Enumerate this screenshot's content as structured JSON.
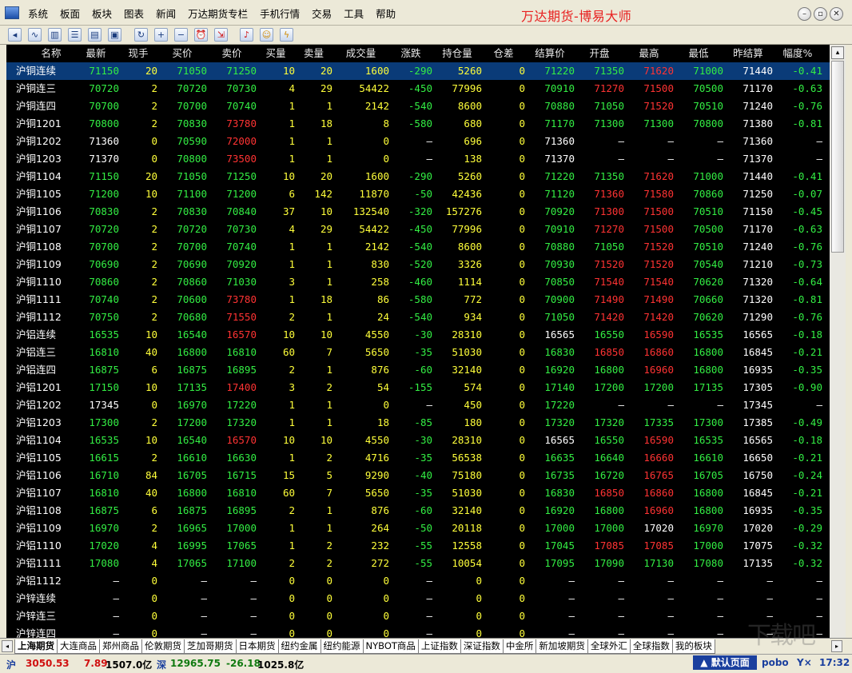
{
  "menu": {
    "items": [
      "系统",
      "板面",
      "板块",
      "图表",
      "新闻",
      "万达期货专栏",
      "手机行情",
      "交易",
      "工具",
      "帮助"
    ],
    "brand": "万达期货-博易大师"
  },
  "window_buttons": [
    "minimize",
    "restore",
    "close"
  ],
  "toolbar": {
    "icons": [
      "back-icon",
      "line-chart-icon",
      "candlestick-icon",
      "quote-list-icon",
      "news-icon",
      "f10-icon",
      "refresh-icon",
      "zoom-in-icon",
      "zoom-out-icon",
      "alarm-clock-icon",
      "export-icon",
      "bell-icon",
      "users-icon",
      "lightning-icon"
    ]
  },
  "columns": [
    "名称",
    "最新",
    "现手",
    "买价",
    "卖价",
    "买量",
    "卖量",
    "成交量",
    "涨跌",
    "持仓量",
    "仓差",
    "结算价",
    "开盘",
    "最高",
    "最低",
    "昨结算",
    "幅度%"
  ],
  "rows": [
    [
      "沪铜连续",
      "71150",
      "20",
      "71050",
      "71250",
      "10",
      "20",
      "1600",
      "-290",
      "5260",
      "0",
      "71220",
      "71350",
      "71620",
      "71000",
      "71440",
      "-0.41"
    ],
    [
      "沪铜连三",
      "70720",
      "2",
      "70720",
      "70730",
      "4",
      "29",
      "54422",
      "-450",
      "77996",
      "0",
      "70910",
      "71270",
      "71500",
      "70500",
      "71170",
      "-0.63"
    ],
    [
      "沪铜连四",
      "70700",
      "2",
      "70700",
      "70740",
      "1",
      "1",
      "2142",
      "-540",
      "8600",
      "0",
      "70880",
      "71050",
      "71520",
      "70510",
      "71240",
      "-0.76"
    ],
    [
      "沪铜1201",
      "70800",
      "2",
      "70830",
      "73780",
      "1",
      "18",
      "8",
      "-580",
      "680",
      "0",
      "71170",
      "71300",
      "71300",
      "70800",
      "71380",
      "-0.81"
    ],
    [
      "沪铜1202",
      "71360",
      "0",
      "70590",
      "72000",
      "1",
      "1",
      "0",
      "—",
      "696",
      "0",
      "71360",
      "—",
      "—",
      "—",
      "71360",
      "—"
    ],
    [
      "沪铜1203",
      "71370",
      "0",
      "70800",
      "73500",
      "1",
      "1",
      "0",
      "—",
      "138",
      "0",
      "71370",
      "—",
      "—",
      "—",
      "71370",
      "—"
    ],
    [
      "沪铜1104",
      "71150",
      "20",
      "71050",
      "71250",
      "10",
      "20",
      "1600",
      "-290",
      "5260",
      "0",
      "71220",
      "71350",
      "71620",
      "71000",
      "71440",
      "-0.41"
    ],
    [
      "沪铜1105",
      "71200",
      "10",
      "71100",
      "71200",
      "6",
      "142",
      "11870",
      "-50",
      "42436",
      "0",
      "71120",
      "71360",
      "71580",
      "70860",
      "71250",
      "-0.07"
    ],
    [
      "沪铜1106",
      "70830",
      "2",
      "70830",
      "70840",
      "37",
      "10",
      "132540",
      "-320",
      "157276",
      "0",
      "70920",
      "71300",
      "71500",
      "70510",
      "71150",
      "-0.45"
    ],
    [
      "沪铜1107",
      "70720",
      "2",
      "70720",
      "70730",
      "4",
      "29",
      "54422",
      "-450",
      "77996",
      "0",
      "70910",
      "71270",
      "71500",
      "70500",
      "71170",
      "-0.63"
    ],
    [
      "沪铜1108",
      "70700",
      "2",
      "70700",
      "70740",
      "1",
      "1",
      "2142",
      "-540",
      "8600",
      "0",
      "70880",
      "71050",
      "71520",
      "70510",
      "71240",
      "-0.76"
    ],
    [
      "沪铜1109",
      "70690",
      "2",
      "70690",
      "70920",
      "1",
      "1",
      "830",
      "-520",
      "3326",
      "0",
      "70930",
      "71520",
      "71520",
      "70540",
      "71210",
      "-0.73"
    ],
    [
      "沪铜1110",
      "70860",
      "2",
      "70860",
      "71030",
      "3",
      "1",
      "258",
      "-460",
      "1114",
      "0",
      "70850",
      "71540",
      "71540",
      "70620",
      "71320",
      "-0.64"
    ],
    [
      "沪铜1111",
      "70740",
      "2",
      "70600",
      "73780",
      "1",
      "18",
      "86",
      "-580",
      "772",
      "0",
      "70900",
      "71490",
      "71490",
      "70660",
      "71320",
      "-0.81"
    ],
    [
      "沪铜1112",
      "70750",
      "2",
      "70680",
      "71550",
      "2",
      "1",
      "24",
      "-540",
      "934",
      "0",
      "71050",
      "71420",
      "71420",
      "70620",
      "71290",
      "-0.76"
    ],
    [
      "沪铝连续",
      "16535",
      "10",
      "16540",
      "16570",
      "10",
      "10",
      "4550",
      "-30",
      "28310",
      "0",
      "16565",
      "16550",
      "16590",
      "16535",
      "16565",
      "-0.18"
    ],
    [
      "沪铝连三",
      "16810",
      "40",
      "16800",
      "16810",
      "60",
      "7",
      "5650",
      "-35",
      "51030",
      "0",
      "16830",
      "16850",
      "16860",
      "16800",
      "16845",
      "-0.21"
    ],
    [
      "沪铝连四",
      "16875",
      "6",
      "16875",
      "16895",
      "2",
      "1",
      "876",
      "-60",
      "32140",
      "0",
      "16920",
      "16800",
      "16960",
      "16800",
      "16935",
      "-0.35"
    ],
    [
      "沪铝1201",
      "17150",
      "10",
      "17135",
      "17400",
      "3",
      "2",
      "54",
      "-155",
      "574",
      "0",
      "17140",
      "17200",
      "17200",
      "17135",
      "17305",
      "-0.90"
    ],
    [
      "沪铝1202",
      "17345",
      "0",
      "16970",
      "17220",
      "1",
      "1",
      "0",
      "—",
      "450",
      "0",
      "17220",
      "—",
      "—",
      "—",
      "17345",
      "—"
    ],
    [
      "沪铝1203",
      "17300",
      "2",
      "17200",
      "17320",
      "1",
      "1",
      "18",
      "-85",
      "180",
      "0",
      "17320",
      "17320",
      "17335",
      "17300",
      "17385",
      "-0.49"
    ],
    [
      "沪铝1104",
      "16535",
      "10",
      "16540",
      "16570",
      "10",
      "10",
      "4550",
      "-30",
      "28310",
      "0",
      "16565",
      "16550",
      "16590",
      "16535",
      "16565",
      "-0.18"
    ],
    [
      "沪铝1105",
      "16615",
      "2",
      "16610",
      "16630",
      "1",
      "2",
      "4716",
      "-35",
      "56538",
      "0",
      "16635",
      "16640",
      "16660",
      "16610",
      "16650",
      "-0.21"
    ],
    [
      "沪铝1106",
      "16710",
      "84",
      "16705",
      "16715",
      "15",
      "5",
      "9290",
      "-40",
      "75180",
      "0",
      "16735",
      "16720",
      "16765",
      "16705",
      "16750",
      "-0.24"
    ],
    [
      "沪铝1107",
      "16810",
      "40",
      "16800",
      "16810",
      "60",
      "7",
      "5650",
      "-35",
      "51030",
      "0",
      "16830",
      "16850",
      "16860",
      "16800",
      "16845",
      "-0.21"
    ],
    [
      "沪铝1108",
      "16875",
      "6",
      "16875",
      "16895",
      "2",
      "1",
      "876",
      "-60",
      "32140",
      "0",
      "16920",
      "16800",
      "16960",
      "16800",
      "16935",
      "-0.35"
    ],
    [
      "沪铝1109",
      "16970",
      "2",
      "16965",
      "17000",
      "1",
      "1",
      "264",
      "-50",
      "20118",
      "0",
      "17000",
      "17000",
      "17020",
      "16970",
      "17020",
      "-0.29"
    ],
    [
      "沪铝1110",
      "17020",
      "4",
      "16995",
      "17065",
      "1",
      "2",
      "232",
      "-55",
      "12558",
      "0",
      "17045",
      "17085",
      "17085",
      "17000",
      "17075",
      "-0.32"
    ],
    [
      "沪铝1111",
      "17080",
      "4",
      "17065",
      "17100",
      "2",
      "2",
      "272",
      "-55",
      "10054",
      "0",
      "17095",
      "17090",
      "17130",
      "17080",
      "17135",
      "-0.32"
    ],
    [
      "沪铝1112",
      "—",
      "0",
      "—",
      "—",
      "0",
      "0",
      "0",
      "—",
      "0",
      "0",
      "—",
      "—",
      "—",
      "—",
      "—",
      "—"
    ],
    [
      "沪锌连续",
      "—",
      "0",
      "—",
      "—",
      "0",
      "0",
      "0",
      "—",
      "0",
      "0",
      "—",
      "—",
      "—",
      "—",
      "—",
      "—"
    ],
    [
      "沪锌连三",
      "—",
      "0",
      "—",
      "—",
      "0",
      "0",
      "0",
      "—",
      "0",
      "0",
      "—",
      "—",
      "—",
      "—",
      "—",
      "—"
    ],
    [
      "沪锌连四",
      "—",
      "0",
      "—",
      "—",
      "0",
      "0",
      "0",
      "—",
      "0",
      "0",
      "—",
      "—",
      "—",
      "—",
      "—",
      "—"
    ]
  ],
  "selected_row": 0,
  "colors": {
    "up": "#ff3333",
    "down": "#33ee44",
    "flat": "#ffffff",
    "volume": "#ffff3a",
    "selected": "#0a3b78"
  },
  "tabs": [
    "上海期货",
    "大连商品",
    "郑州商品",
    "伦敦期货",
    "芝加哥期货",
    "日本期货",
    "纽约金属",
    "纽约能源",
    "NYBOT商品",
    "上证指数",
    "深证指数",
    "中金所",
    "新加坡期货",
    "全球外汇",
    "全球指数",
    "我的板块"
  ],
  "active_tab": 0,
  "status": {
    "sh_label": "沪",
    "sh_index": "3050.53",
    "sh_change": "7.89",
    "sh_amount": "1507.0亿",
    "sz_label": "深",
    "sz_index": "12965.75",
    "sz_change": "-26.18",
    "sz_amount": "1025.8亿",
    "default_page": "默认页面",
    "broker": "pobo",
    "time": "17:32"
  },
  "watermark": "下载吧"
}
